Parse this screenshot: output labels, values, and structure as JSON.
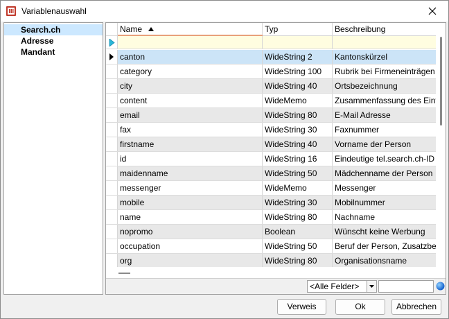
{
  "window": {
    "title": "Variablenauswahl"
  },
  "tree": {
    "items": [
      {
        "label": "Search.ch",
        "selected": true
      },
      {
        "label": "Adresse",
        "selected": false
      },
      {
        "label": "Mandant",
        "selected": false
      }
    ]
  },
  "grid": {
    "columns": [
      "Name",
      "Typ",
      "Beschreibung"
    ],
    "sort_column": "Name",
    "sort_direction": "ascending",
    "rows": [
      {
        "name": "canton",
        "typ": "WideString   2",
        "desc": "Kantonskürzel"
      },
      {
        "name": "category",
        "typ": "WideString 100",
        "desc": "Rubrik bei Firmeneinträgen (mel"
      },
      {
        "name": "city",
        "typ": "WideString  40",
        "desc": "Ortsbezeichnung"
      },
      {
        "name": "content",
        "typ": "WideMemo",
        "desc": "Zusammenfassung des Eintrags"
      },
      {
        "name": "email",
        "typ": "WideString  80",
        "desc": "E-Mail Adresse"
      },
      {
        "name": "fax",
        "typ": "WideString  30",
        "desc": "Faxnummer"
      },
      {
        "name": "firstname",
        "typ": "WideString  40",
        "desc": "Vorname der Person"
      },
      {
        "name": "id",
        "typ": "WideString  16",
        "desc": "Eindeutige tel.search.ch-ID des"
      },
      {
        "name": "maidenname",
        "typ": "WideString  50",
        "desc": "Mädchenname der Person"
      },
      {
        "name": "messenger",
        "typ": "WideMemo",
        "desc": "Messenger"
      },
      {
        "name": "mobile",
        "typ": "WideString  30",
        "desc": "Mobilnummer"
      },
      {
        "name": "name",
        "typ": "WideString  80",
        "desc": "Nachname"
      },
      {
        "name": "nopromo",
        "typ": "Boolean",
        "desc": "Wünscht keine Werbung"
      },
      {
        "name": "occupation",
        "typ": "WideString  50",
        "desc": "Beruf der Person, Zusatzbezeic"
      },
      {
        "name": "org",
        "typ": "WideString  80",
        "desc": "Organisationsname"
      }
    ]
  },
  "filter": {
    "field_combo_value": "<Alle Felder>",
    "search_value": ""
  },
  "buttons": {
    "verweis": "Verweis",
    "ok": "Ok",
    "abbrechen": "Abbrechen"
  },
  "colors": {
    "selection": "#cce4f7",
    "tree_selection": "#cce8ff",
    "alt_row": "#e8e8e8",
    "filter_row": "#fffde0",
    "sort_accent": "#e8a07a"
  },
  "icons": {
    "app": "document-icon",
    "close": "close-icon",
    "filter_row": "arrow-right-icon",
    "current_row": "row-pointer-icon",
    "combo": "dropdown-arrow-icon",
    "search": "globe-icon"
  }
}
